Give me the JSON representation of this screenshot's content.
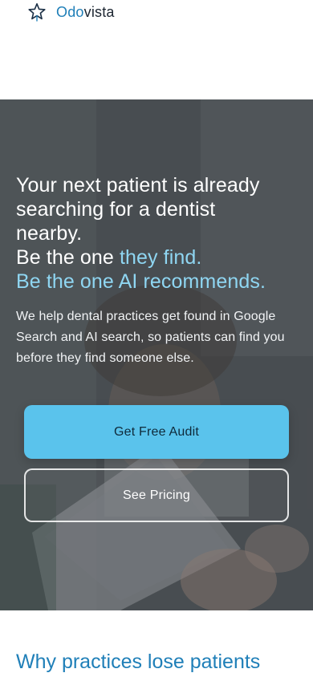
{
  "brand": {
    "name_part1": "Odo",
    "name_part2": "vista",
    "icon": "star-outline-icon",
    "colors": {
      "primary": "#1f7fb8",
      "dark": "#1b2430"
    }
  },
  "hero": {
    "headline_line1": "Your next patient is already",
    "headline_line2": "searching for a dentist",
    "headline_line3": "nearby.",
    "headline_line4_white": "Be the one ",
    "headline_line4_blue": "they find.",
    "headline_line5": "Be the one AI recommends.",
    "subtext": "We help dental practices get found in Google Search and AI search, so patients can find you before they find someone else.",
    "primary_cta": "Get Free Audit",
    "secondary_cta": "See Pricing",
    "colors": {
      "accent": "#5ac3ec",
      "highlight": "#8fd6f2"
    }
  },
  "section": {
    "title": "Why practices lose patients"
  }
}
